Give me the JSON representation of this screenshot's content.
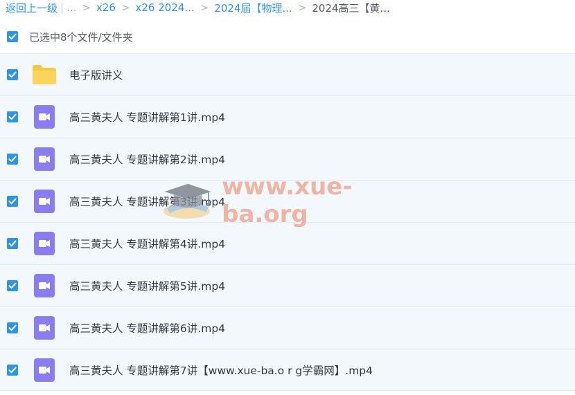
{
  "breadcrumb": {
    "back": "返回上一级",
    "bar": "|",
    "dots": "...",
    "items": [
      "x26",
      "x26 2024...",
      "2024届【物理...",
      "2024高三【黄..."
    ]
  },
  "selection": {
    "label": "已选中8个文件/文件夹"
  },
  "files": [
    {
      "name": "电子版讲义",
      "icon": "folder-icon"
    },
    {
      "name": "高三黄夫人 专题讲解第1讲.mp4",
      "icon": "video-file-icon"
    },
    {
      "name": "高三黄夫人 专题讲解第2讲.mp4",
      "icon": "video-file-icon"
    },
    {
      "name": "高三黄夫人 专题讲解第3讲.mp4",
      "icon": "video-file-icon"
    },
    {
      "name": "高三黄夫人 专题讲解第4讲.mp4",
      "icon": "video-file-icon"
    },
    {
      "name": "高三黄夫人 专题讲解第5讲.mp4",
      "icon": "video-file-icon"
    },
    {
      "name": "高三黄夫人 专题讲解第6讲.mp4",
      "icon": "video-file-icon"
    },
    {
      "name": "高三黄夫人 专题讲解第7讲【www.xue-ba.o r g学霸网】.mp4",
      "icon": "video-file-icon"
    }
  ],
  "watermark": {
    "text": "www.xue-ba.org"
  },
  "colors": {
    "accent": "#2e95e5",
    "folder": "#fbd55b",
    "video": "#8b7cf0",
    "row_bg": "#f3f8fd"
  }
}
